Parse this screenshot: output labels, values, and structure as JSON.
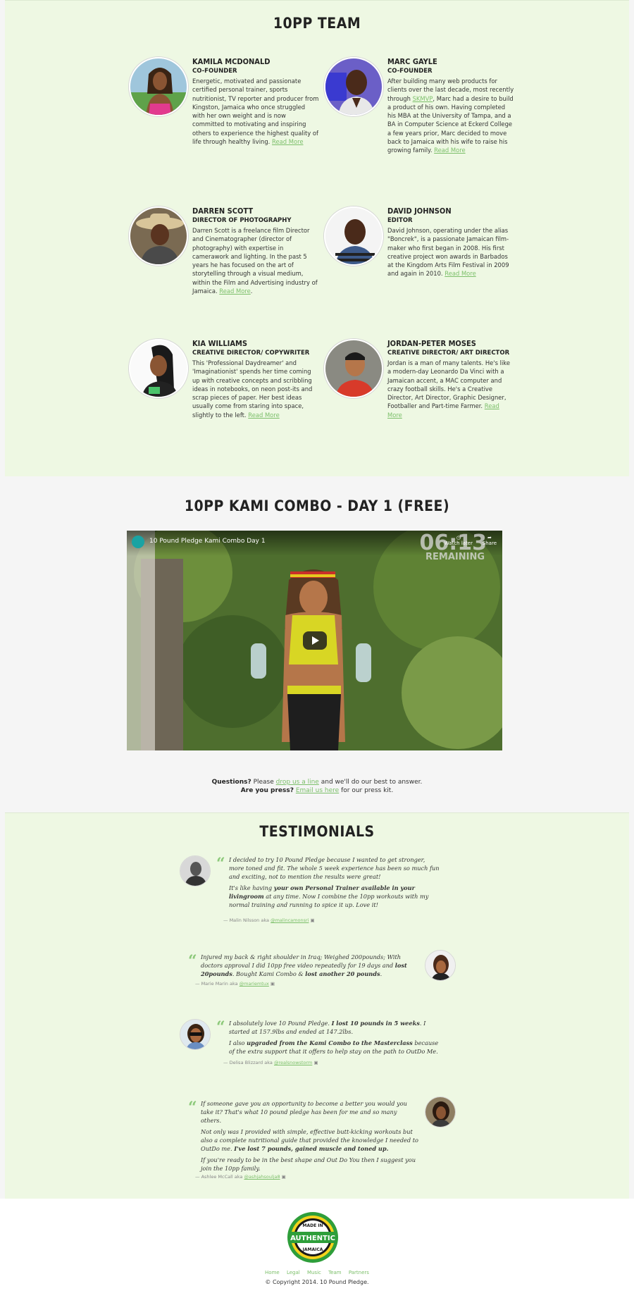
{
  "team": {
    "title": "10PP TEAM",
    "members": [
      {
        "name": "KAMILA MCDONALD",
        "role": "CO-FOUNDER",
        "bio": "Energetic, motivated and passionate certified personal trainer, sports nutritionist, TV reporter and producer from Kingston, Jamaica who once struggled with her own weight and is now committed to motivating and inspiring others to experience the highest quality of life through healthy living.",
        "link": "Read More"
      },
      {
        "name": "MARC GAYLE",
        "role": "CO-FOUNDER",
        "bio_pre": "After building many web products for clients over the last decade, most recently through",
        "bio_link": "SKMVP",
        "bio_post": ", Marc had a desire to build a product of his own. Having completed his MBA at the University of Tampa, and a BA in Computer Science at Eckerd College a few years prior, Marc decided to move back to Jamaica with his wife to raise his growing family.",
        "link": "Read More"
      },
      {
        "name": "DARREN SCOTT",
        "role": "DIRECTOR OF PHOTOGRAPHY",
        "bio": "Darren Scott is a freelance film Director and Cinematographer (director of photography) with expertise in camerawork and lighting. In the past 5 years he has focused on the art of storytelling through a visual medium, within the Film and Advertising industry of Jamaica.",
        "link": "Read More"
      },
      {
        "name": "DAVID JOHNSON",
        "role": "EDITOR",
        "bio": "David Johnson, operating under the alias \"Boncrek\", is a passionate Jamaican film-maker who first began in 2008. His first creative project won awards in Barbados at the Kingdom Arts Film Festival in 2009 and again in 2010.",
        "link": "Read More"
      },
      {
        "name": "KIA WILLIAMS",
        "role": "CREATIVE DIRECTOR/ COPYWRITER",
        "bio": "This 'Professional Daydreamer' and 'Imaginationist' spends her time coming up with creative concepts and scribbling ideas in notebooks, on neon post-its and scrap pieces of paper. Her best ideas usually come from staring into space, slightly to the left.",
        "link": "Read More"
      },
      {
        "name": "JORDAN-PETER MOSES",
        "role": "CREATIVE DIRECTOR/ ART DIRECTOR",
        "bio": "Jordan is a man of many talents. He's like a modern-day Leonardo Da Vinci with a Jamaican accent, a MAC computer and crazy football skills. He's a Creative Director, Art Director, Graphic Designer, Footballer and Part-time Farmer.",
        "link": "Read More"
      }
    ]
  },
  "video": {
    "title": "10PP KAMI COMBO - DAY 1 (FREE)",
    "video_title": "10 Pound Pledge Kami Combo Day 1",
    "timer": "06:13",
    "timer_label": "REMAINING",
    "watch_later": "Watch later",
    "share": "Share",
    "questions_bold": "Questions?",
    "questions_pre": "Please",
    "questions_link": "drop us a line",
    "questions_post": "and we'll do our best to answer.",
    "press_bold": "Are you press?",
    "press_link": "Email us here",
    "press_post": "for our press kit."
  },
  "testimonials": {
    "title": "TESTIMONIALS",
    "items": [
      {
        "author": "— Malin Nilsson aka",
        "handle": "@malincamonsri"
      },
      {
        "author": "— Marie Marin aka",
        "handle": "@mariemtux"
      },
      {
        "author": "— Delisa Blizzard aka",
        "handle": "@realsnowstorm"
      },
      {
        "author": "— Ashlee McCall aka",
        "handle": "@ashjahsoulja8"
      }
    ],
    "q1_a": "I decided to try 10 Pound Pledge because I wanted to get stronger, more toned and fit. The whole 5 week experience has been so much fun and exciting, not to mention the results were great!",
    "q1_b_pre": "It's like having",
    "q1_b_bold": "your own Personal Trainer available in your livingroom",
    "q1_b_post": "at any time. Now I combine the 10pp workouts with my normal training and running to spice it up. Love it!",
    "q2_pre": "Injured my back & right shoulder in Iraq; Weighed 200pounds; With doctors approval I did 10pp free video repeatedly for 19 days and",
    "q2_bold1": "lost 20pounds",
    "q2_mid": ". Bought Kami Combo &",
    "q2_bold2": "lost another 20 pounds",
    "q2_end": ".",
    "q3_a_pre": "I absolutely love 10 Pound Pledge.",
    "q3_a_bold": "I lost 10 pounds in 5 weeks",
    "q3_a_post": ". I started at 157.9lbs and ended at 147.2lbs.",
    "q3_b_pre": "I also",
    "q3_b_bold": "upgraded from the Kami Combo to the Masterclass",
    "q3_b_post": "because of the extra support that it offers to help stay on the path to OutDo Me.",
    "q4_a": "If someone gave you an opportunity to become a better you would you take it? That's what 10 pound pledge has been for me and so many others.",
    "q4_b": "Not only was I provided with simple, effective butt-kicking workouts but also a complete nutritional guide that provided the knowledge I needed to OutDo me.",
    "q4_b_bold": "I've lost 7 pounds, gained muscle and toned up.",
    "q4_c": "If you're ready to be in the best shape and Out Do You then I suggest you join the 10pp family."
  },
  "footer": {
    "badge_top": "MADE IN",
    "badge_mid": "AUTHENTIC",
    "badge_bottom": "JAMAICA",
    "links": [
      "Home",
      "Legal",
      "Music",
      "Team",
      "Partners"
    ],
    "copyright": "© Copyright 2014. 10 Pound Pledge."
  },
  "colors": {
    "accent": "#7cbf6a",
    "section_bg": "#eef8e3",
    "badge_green": "#2e9e3a",
    "badge_yellow": "#f4d21c"
  }
}
